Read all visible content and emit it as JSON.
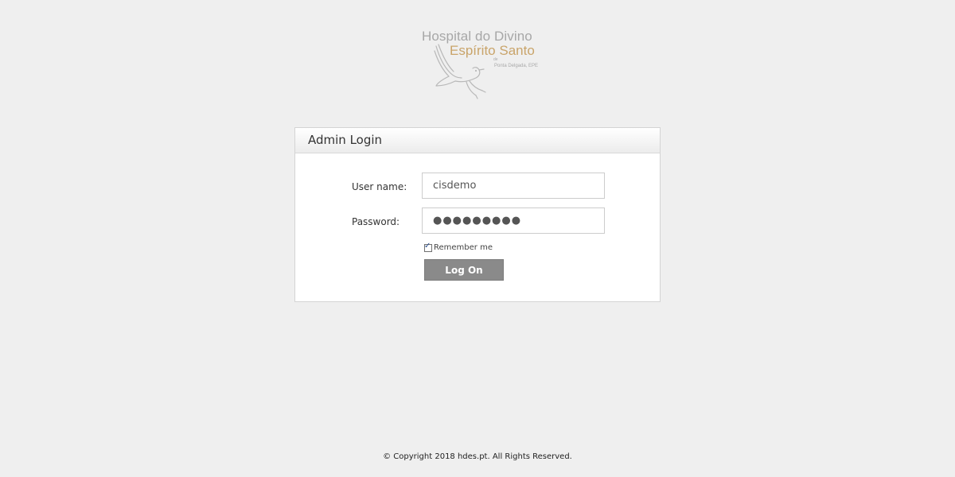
{
  "logo": {
    "line1": "Hospital do Divino",
    "line2": "Espírito Santo",
    "line_de": "de",
    "line3": "Ponta Delgada, EPE",
    "icon": "dove-icon",
    "accent_color": "#c9a46a",
    "text_color": "#a7a7a7"
  },
  "panel": {
    "title": "Admin Login",
    "username": {
      "label": "User name:",
      "value": "cisdemo"
    },
    "password": {
      "label": "Password:",
      "value": "●●●●●●●●●"
    },
    "remember": {
      "label": "Remember me",
      "checked": true
    },
    "submit_label": "Log On",
    "button_color": "#8a8a8a"
  },
  "footer": {
    "copyright": "© Copyright 2018 hdes.pt. All Rights Reserved."
  }
}
